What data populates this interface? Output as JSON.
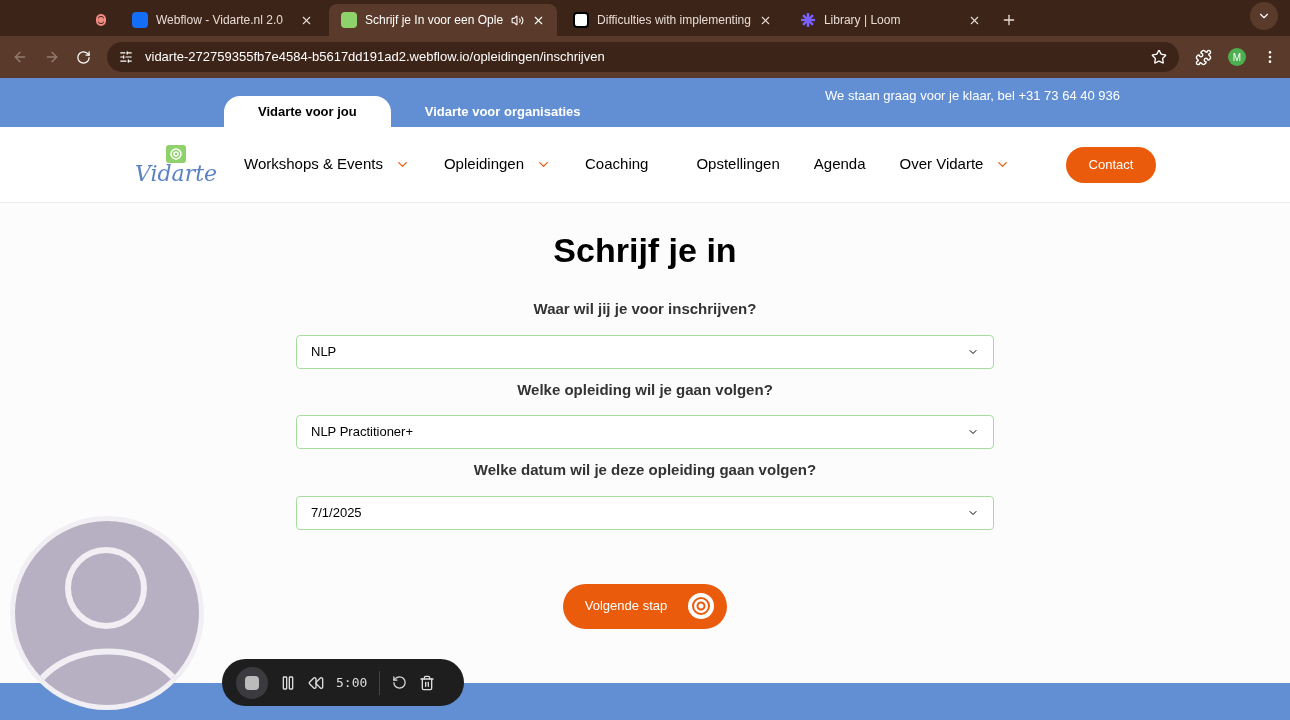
{
  "browser": {
    "tabs": [
      {
        "kind": "record",
        "selected": false
      },
      {
        "kind": "webflow",
        "title": "Webflow - Vidarte.nl 2.0",
        "selected": false
      },
      {
        "kind": "site",
        "title": "Schrijf je In voor een Ople",
        "selected": true
      },
      {
        "kind": "doc",
        "title": "Difficulties with implementing",
        "selected": false
      },
      {
        "kind": "loom",
        "title": "Library | Loom",
        "selected": false
      }
    ],
    "url": "vidarte-272759355fb7e4584-b5617dd191ad2.webflow.io/opleidingen/inschrijven",
    "profile": "M"
  },
  "topbar": {
    "tabs": [
      {
        "label": "Vidarte voor jou",
        "selected": true
      },
      {
        "label": "Vidarte voor organisaties",
        "selected": false
      }
    ],
    "phone": "We staan graag voor je klaar, bel +31 73 64 40 936"
  },
  "nav": {
    "logo": "Vidarte",
    "items": [
      {
        "label": "Workshops & Events",
        "dropdown": true
      },
      {
        "label": "Opleidingen",
        "dropdown": true
      },
      {
        "label": "Coaching",
        "dropdown": false
      },
      {
        "label": "Opstellingen",
        "dropdown": false
      },
      {
        "label": "Agenda",
        "dropdown": false
      },
      {
        "label": "Over Vidarte",
        "dropdown": true
      }
    ],
    "cta": "Contact"
  },
  "form": {
    "title": "Schrijf je in",
    "fields": [
      {
        "label": "Waar wil jij je voor inschrijven?",
        "value": "NLP"
      },
      {
        "label": "Welke opleiding wil je gaan volgen?",
        "value": "NLP Practitioner+"
      },
      {
        "label": "Welke datum wil je deze opleiding gaan volgen?",
        "value": "7/1/2025"
      }
    ],
    "submit": "Volgende stap"
  },
  "recorder": {
    "time": "5:00"
  }
}
